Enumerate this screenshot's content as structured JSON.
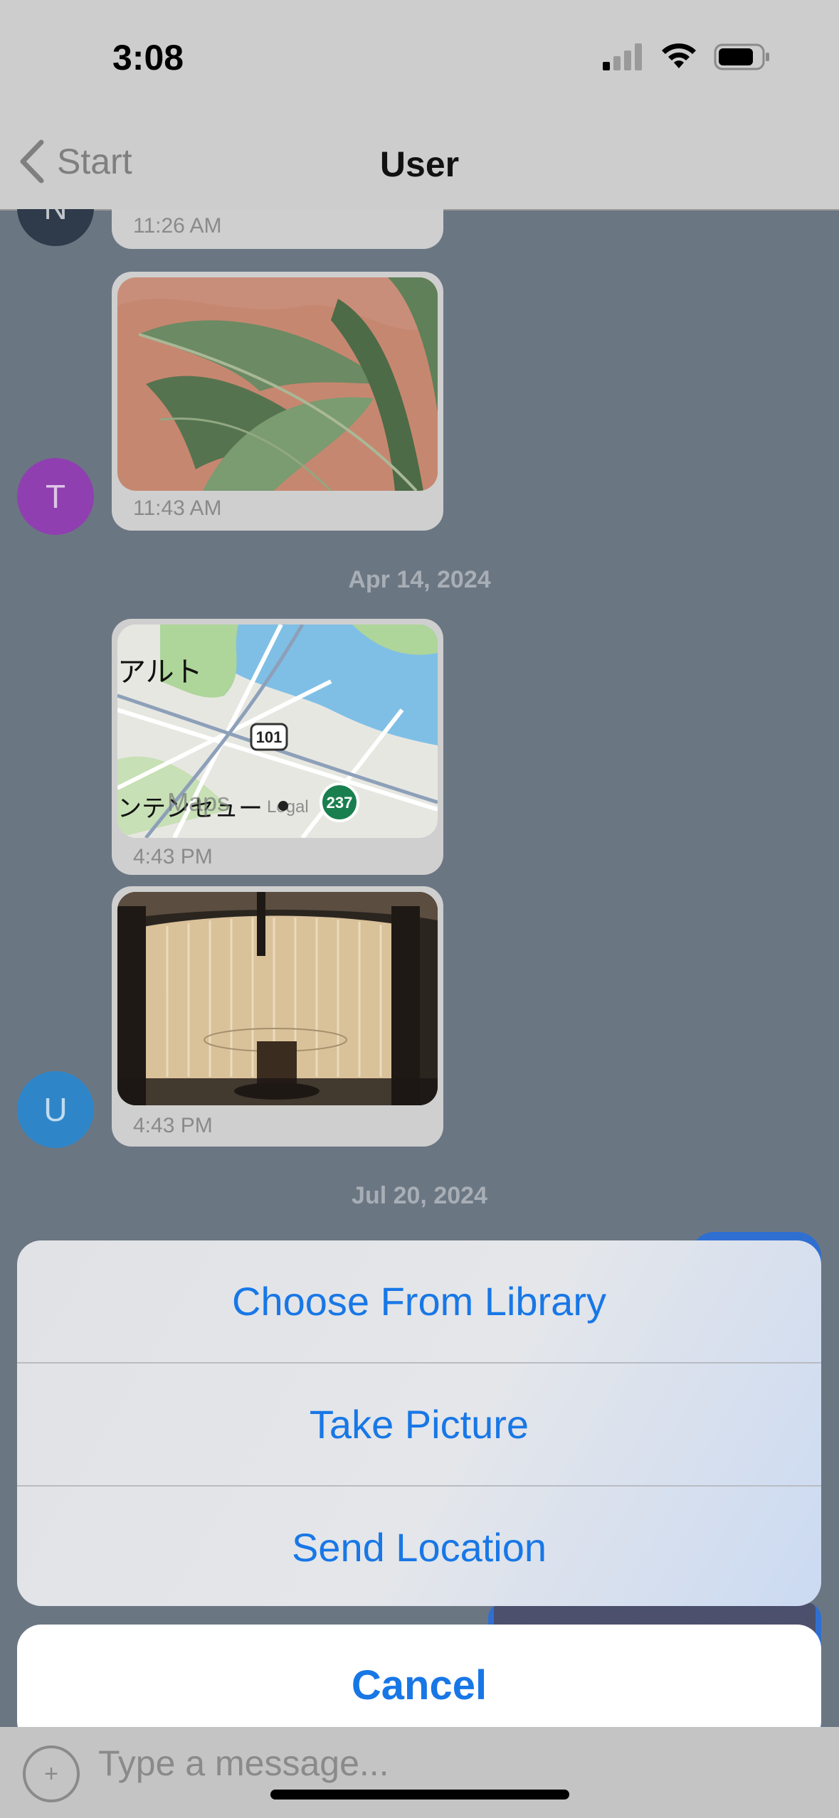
{
  "status_bar": {
    "time": "3:08",
    "signal_icon": "cellular-signal-icon",
    "wifi_icon": "wifi-icon",
    "battery_icon": "battery-icon"
  },
  "nav": {
    "back_label": "Start",
    "title": "User"
  },
  "messages": [
    {
      "avatar": "N",
      "avatar_color": "#2f3b4a",
      "time": "11:26 AM",
      "kind": "text"
    },
    {
      "avatar": "T",
      "avatar_color": "#8f3fb0",
      "time": "11:43 AM",
      "kind": "image",
      "image": "banana-leaf-photo"
    },
    {
      "date": "Apr 14, 2024"
    },
    {
      "avatar": "",
      "time": "4:43 PM",
      "kind": "map",
      "map": {
        "label_text": "アルト",
        "highway_label": "101",
        "route_label": "237",
        "bottom_text": "ンテンセュー",
        "maps_label": "Maps",
        "legal_label": "Legal"
      }
    },
    {
      "avatar": "U",
      "avatar_color": "#2e86c8",
      "time": "4:43 PM",
      "kind": "image",
      "image": "lounge-interior-photo"
    },
    {
      "date": "Jul 20, 2024"
    }
  ],
  "action_sheet": {
    "options": [
      "Choose From Library",
      "Take Picture",
      "Send Location"
    ],
    "cancel": "Cancel",
    "accent_color": "#1877e6"
  },
  "composer": {
    "placeholder": "Type a message...",
    "attach_symbol": "+"
  }
}
